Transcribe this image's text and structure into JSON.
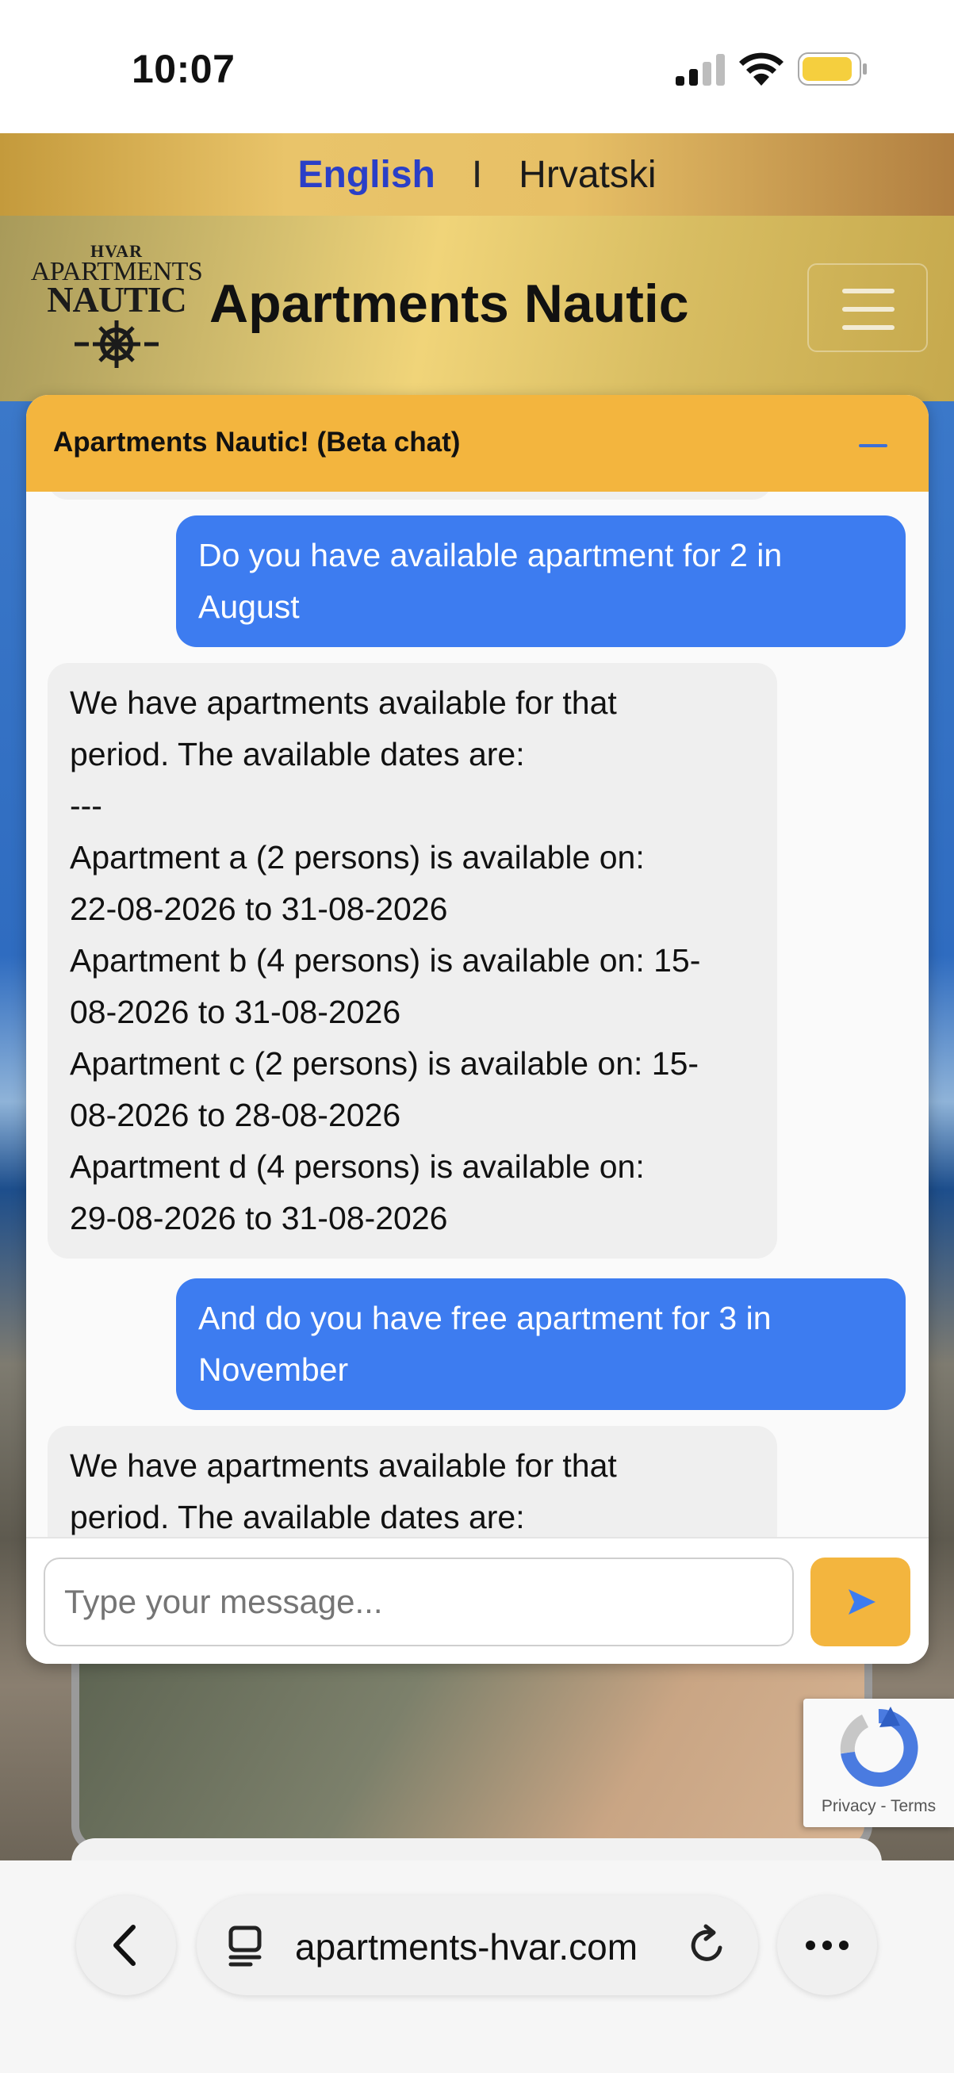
{
  "status_bar": {
    "time": "10:07"
  },
  "language": {
    "english": "English",
    "separator": "I",
    "croatian": "Hrvatski"
  },
  "header": {
    "logo": {
      "line1": "HVAR",
      "line2": "APARTMENTS",
      "line3": "NAUTIC"
    },
    "title": "Apartments Nautic"
  },
  "chat": {
    "title": "Apartments Nautic! (Beta chat)",
    "messages": [
      {
        "role": "user",
        "lines": [
          "Do you have available apartment for 2 in",
          "August"
        ]
      },
      {
        "role": "bot",
        "lines": [
          "We have apartments available for that",
          "period. The available dates are:",
          "---",
          "Apartment a (2 persons) is available on:",
          "22-08-2026 to 31-08-2026",
          "Apartment b (4 persons) is available on: 15-",
          "08-2026 to 31-08-2026",
          "Apartment c (2 persons) is available on: 15-",
          "08-2026 to 28-08-2026",
          "Apartment d (4 persons) is available on:",
          "29-08-2026 to 31-08-2026"
        ]
      },
      {
        "role": "user",
        "lines": [
          "And do you have free apartment for 3 in",
          "November"
        ]
      },
      {
        "role": "bot",
        "lines": [
          "We have apartments available for that",
          "period. The available dates are:"
        ]
      }
    ],
    "input_placeholder": "Type your message...",
    "send_icon": "send-arrow-icon"
  },
  "recaptcha": {
    "privacy": "Privacy",
    "dash": "-",
    "terms": "Terms"
  },
  "browser": {
    "url": "apartments-hvar.com"
  },
  "colors": {
    "chat_header": "#f3b53e",
    "user_bubble": "#3d7cf0",
    "bot_bubble": "#efefef",
    "language_active": "#2a3fc7"
  }
}
